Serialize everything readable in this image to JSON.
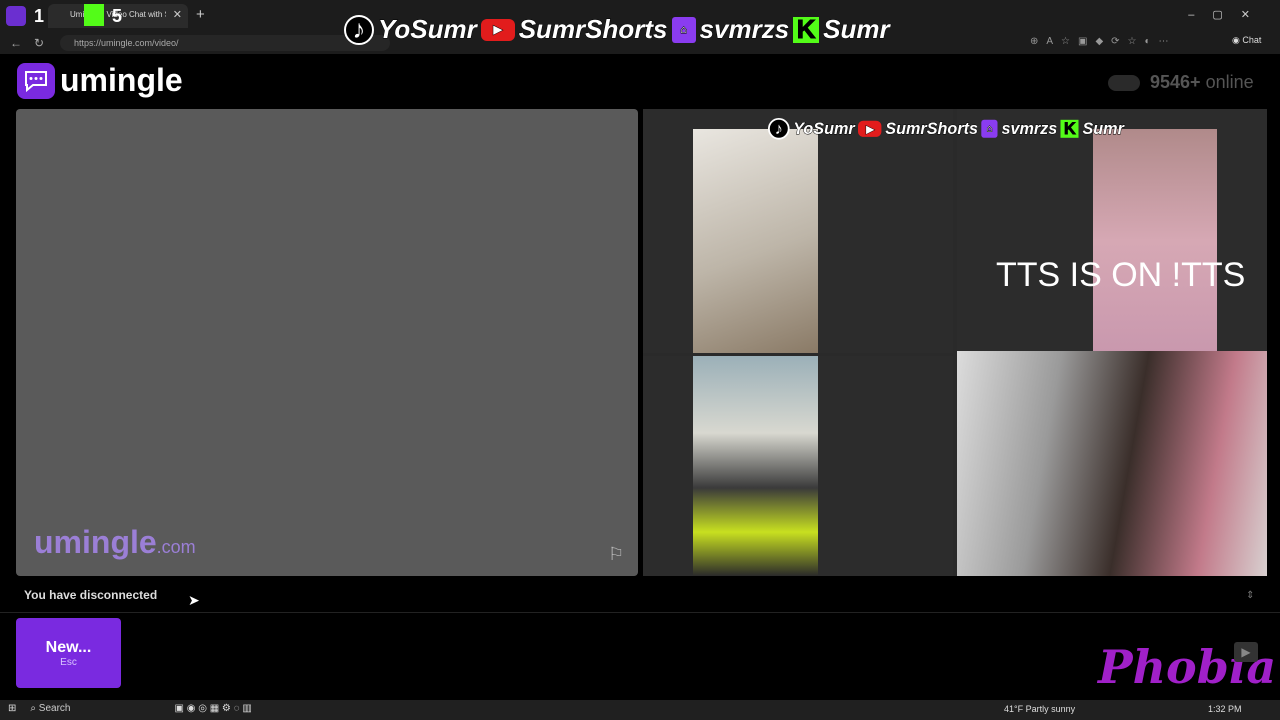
{
  "browser": {
    "tab_title": "Umingle - Video Chat with Strangers",
    "url": "https://umingle.com/video/",
    "chat_label": "Chat",
    "overlay_number_1": "1",
    "overlay_number_2": "5"
  },
  "overlay": {
    "top": {
      "handle_tiktok": "YoSumr",
      "handle_youtube": "SumrShorts",
      "handle_twitch": "svmrzs",
      "handle_kick": "Sumr"
    },
    "mid": {
      "handle_tiktok": "YoSumr",
      "handle_youtube": "SumrShorts",
      "handle_twitch": "svmrzs",
      "handle_kick": "Sumr"
    },
    "tts_text": "TTS IS ON !TTS",
    "brand_overlay": "Phobia"
  },
  "site": {
    "logo_text": "umingle",
    "online_count": "9546+",
    "online_label": "online",
    "watermark_main": "umingle",
    "watermark_tld": ".com",
    "status": "You have disconnected",
    "new_button_label": "New...",
    "new_button_hint": "Esc"
  },
  "taskbar": {
    "search_label": "Search",
    "weather": "41°F  Partly sunny",
    "time": "1:32 PM"
  },
  "colors": {
    "accent": "#7a2ae0",
    "panel": "#5a5a5a"
  }
}
